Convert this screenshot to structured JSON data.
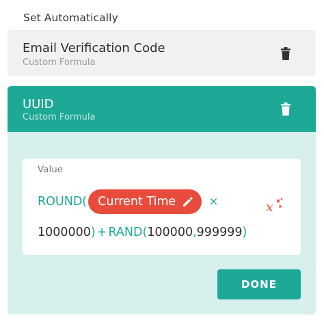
{
  "section_label": "Set Automatically",
  "items": [
    {
      "title": "Email Verification Code",
      "subtitle": "Custom Formula"
    }
  ],
  "active_item": {
    "title": "UUID",
    "subtitle": "Custom Formula",
    "value_label": "Value",
    "formula": {
      "fn_round_open": "ROUND(",
      "pill_label": "Current Time",
      "times": "×",
      "multiplier": "1000000",
      "close_paren": ")",
      "plus": "+",
      "fn_rand_open": "RAND(",
      "arg1": "100000",
      "comma": ",",
      "arg2": "999999",
      "end_paren": ")"
    },
    "done_label": "DONE"
  },
  "colors": {
    "accent": "#1ea896",
    "pill": "#e84b3c",
    "panel_bg": "#d7efed",
    "card_bg": "#f1f1f1"
  },
  "icons": {
    "delete": "trash-icon",
    "edit": "pencil-icon",
    "variables": "variables-icon"
  }
}
